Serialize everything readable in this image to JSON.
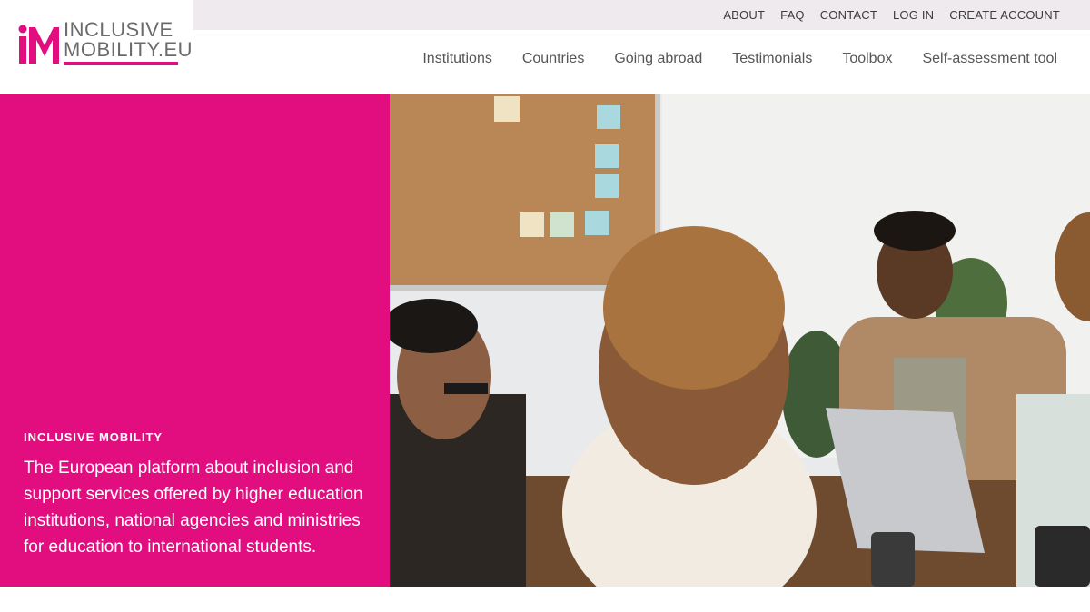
{
  "brand": {
    "line1": "INCLUSIVE",
    "line2": "MOBILITY.EU",
    "accent_color": "#e20e80"
  },
  "top_links": [
    "ABOUT",
    "FAQ",
    "CONTACT",
    "LOG IN",
    "CREATE ACCOUNT"
  ],
  "main_nav": [
    "Institutions",
    "Countries",
    "Going abroad",
    "Testimonials",
    "Toolbox",
    "Self-assessment tool"
  ],
  "hero": {
    "kicker": "INCLUSIVE MOBILITY",
    "text": "The European platform about inclusion and support services offered by higher education institutions, national agencies and ministries for education to international students."
  }
}
